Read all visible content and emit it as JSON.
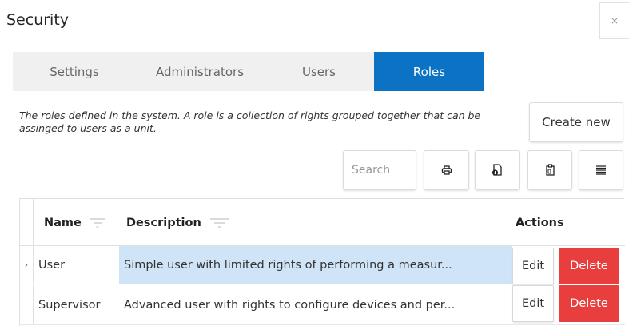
{
  "dialog": {
    "title": "Security",
    "close_icon": "×"
  },
  "tabs": [
    {
      "label": "Settings",
      "active": false
    },
    {
      "label": "Administrators",
      "active": false
    },
    {
      "label": "Users",
      "active": false
    },
    {
      "label": "Roles",
      "active": true
    }
  ],
  "description": "The roles defined in the system. A role is a collection of rights grouped together that can be assinged to users as a unit.",
  "toolbar": {
    "create_label": "Create new",
    "search_placeholder": "Search",
    "icons": [
      "print-icon",
      "export-icon",
      "copy-icon",
      "columns-icon"
    ]
  },
  "grid": {
    "columns": {
      "name": "Name",
      "description": "Description",
      "actions": "Actions"
    },
    "rows": [
      {
        "expander": "›",
        "name": "User",
        "description": "Simple user with limited rights of performing a measur...",
        "edit": "Edit",
        "delete": "Delete",
        "selected": true
      },
      {
        "expander": "",
        "name": "Supervisor",
        "description": "Advanced user with rights to configure devices and per...",
        "edit": "Edit",
        "delete": "Delete",
        "selected": false
      }
    ]
  },
  "colors": {
    "accent": "#0b72c4",
    "danger": "#e83e3e",
    "selected_row": "#cfe4f7",
    "tab_bg": "#f0f0f0"
  }
}
